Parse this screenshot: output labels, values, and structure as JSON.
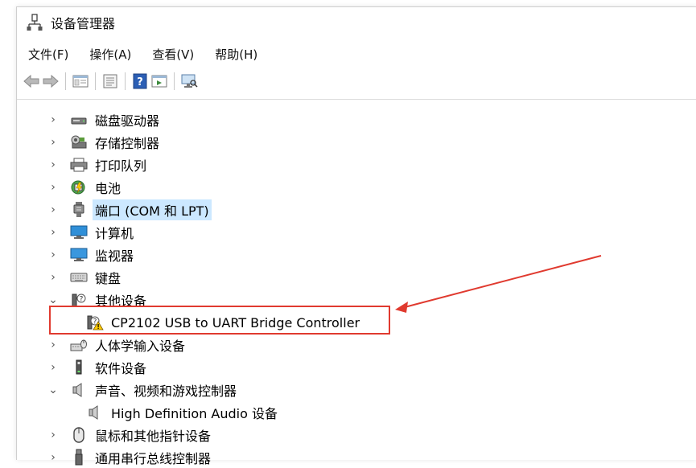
{
  "window": {
    "title": "设备管理器"
  },
  "menu": [
    {
      "label": "文件(F)"
    },
    {
      "label": "操作(A)"
    },
    {
      "label": "查看(V)"
    },
    {
      "label": "帮助(H)"
    }
  ],
  "toolbar": {
    "buttons": [
      {
        "icon": "back-arrow-icon"
      },
      {
        "icon": "forward-arrow-icon"
      },
      {
        "icon": "show-hide-tree-icon"
      },
      {
        "icon": "properties-icon"
      },
      {
        "icon": "help-icon"
      },
      {
        "icon": "action-pane-icon"
      },
      {
        "icon": "scan-hardware-icon"
      }
    ]
  },
  "tree": {
    "items": [
      {
        "label": "磁盘驱动器",
        "expanded": false,
        "icon": "disk-drive-icon"
      },
      {
        "label": "存储控制器",
        "expanded": false,
        "icon": "storage-controller-icon"
      },
      {
        "label": "打印队列",
        "expanded": false,
        "icon": "printer-icon"
      },
      {
        "label": "电池",
        "expanded": false,
        "icon": "battery-icon"
      },
      {
        "label": "端口 (COM 和 LPT)",
        "expanded": false,
        "selected": true,
        "icon": "port-icon"
      },
      {
        "label": "计算机",
        "expanded": false,
        "icon": "computer-icon"
      },
      {
        "label": "监视器",
        "expanded": false,
        "icon": "monitor-icon"
      },
      {
        "label": "键盘",
        "expanded": false,
        "icon": "keyboard-icon"
      },
      {
        "label": "其他设备",
        "expanded": true,
        "icon": "other-devices-icon",
        "children": [
          {
            "label": "CP2102 USB to UART Bridge Controller",
            "icon": "unknown-device-warning-icon",
            "status": "warning"
          }
        ]
      },
      {
        "label": "人体学输入设备",
        "expanded": false,
        "icon": "hid-icon"
      },
      {
        "label": "软件设备",
        "expanded": false,
        "icon": "software-device-icon"
      },
      {
        "label": "声音、视频和游戏控制器",
        "expanded": true,
        "icon": "sound-icon",
        "children": [
          {
            "label": "High Definition Audio 设备",
            "icon": "speaker-icon"
          }
        ]
      },
      {
        "label": "鼠标和其他指针设备",
        "expanded": false,
        "icon": "mouse-icon"
      },
      {
        "label": "通用串行总线控制器",
        "expanded": false,
        "icon": "usb-icon"
      }
    ]
  },
  "annotation": {
    "highlight_color": "#e03a2f"
  },
  "colors": {
    "selection": "#cce8ff",
    "accent": "#0078d7"
  }
}
